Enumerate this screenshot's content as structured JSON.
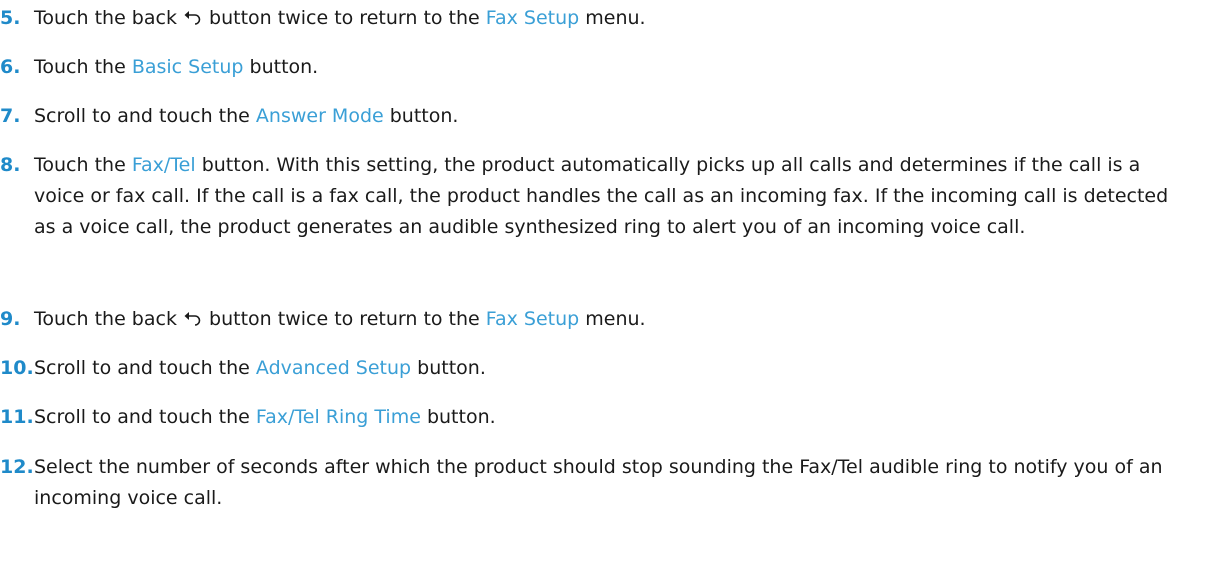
{
  "colors": {
    "step_number": "#1f8ac9",
    "menu_link": "#3a9fd6",
    "body_text": "#1a1a1a"
  },
  "steps": [
    {
      "number": "5.",
      "t1": "Touch the back",
      "icon": "back-arrow-icon",
      "t2": "button twice to return to the",
      "link": "Fax Setup",
      "t3": "menu."
    },
    {
      "number": "6.",
      "t1": "Touch the",
      "link": "Basic Setup",
      "t2": "button."
    },
    {
      "number": "7.",
      "t1": "Scroll to and touch the",
      "link": "Answer Mode",
      "t2": "button."
    },
    {
      "number": "8.",
      "t1": "Touch the",
      "link": "Fax/Tel",
      "t2": "button. With this setting, the product automatically picks up all calls and determines if the call is a voice or fax call. If the call is a fax call, the product handles the call as an incoming fax. If the incoming call is detected as a voice call, the product generates an audible synthesized ring to alert you of an incoming voice call."
    },
    {
      "number": "9.",
      "t1": "Touch the back",
      "icon": "back-arrow-icon",
      "t2": "button twice to return to the",
      "link": "Fax Setup",
      "t3": "menu."
    },
    {
      "number": "10.",
      "t1": "Scroll to and touch the",
      "link": "Advanced Setup",
      "t2": "button."
    },
    {
      "number": "11.",
      "t1": "Scroll to and touch the",
      "link": "Fax/Tel Ring Time",
      "t2": "button."
    },
    {
      "number": "12.",
      "t1": "Select the number of seconds after which the product should stop sounding the Fax/Tel audible ring to notify you of an incoming voice call."
    }
  ]
}
